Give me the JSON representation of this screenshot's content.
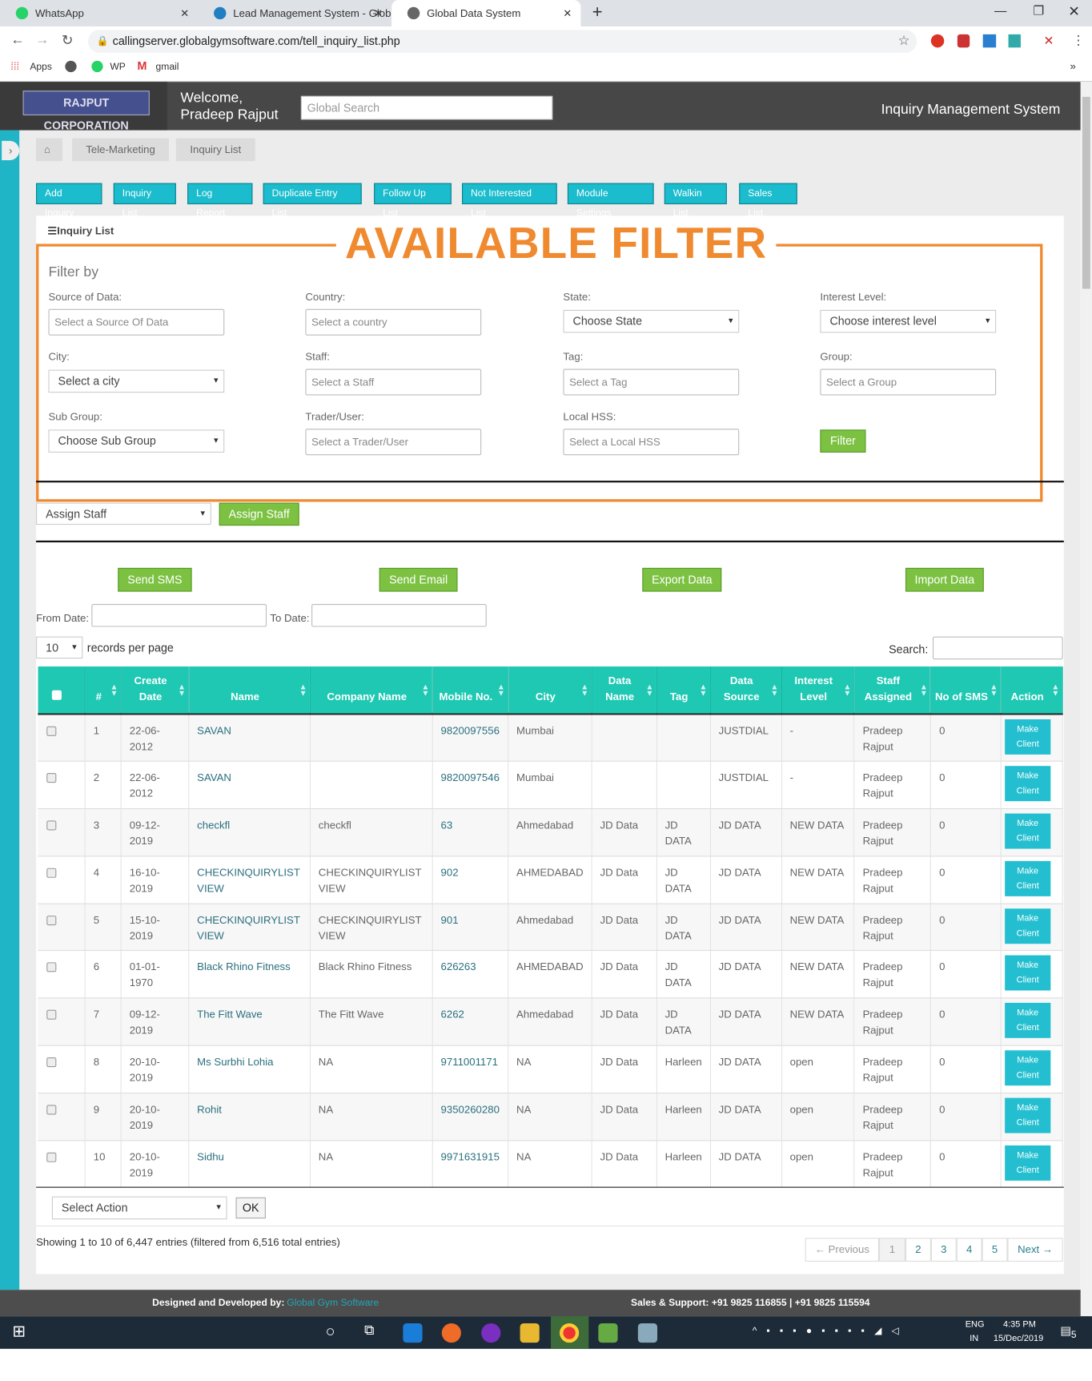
{
  "browser": {
    "tabs": [
      {
        "label": "WhatsApp",
        "color": "#25d366"
      },
      {
        "label": "Lead Management System - Glob",
        "color": "#1f7fc0"
      },
      {
        "label": "Global Data System",
        "color": "#555"
      }
    ],
    "url": "callingserver.globalgymsoftware.com/tell_inquiry_list.php",
    "bookmarks": [
      "Apps",
      "WP",
      "gmail"
    ]
  },
  "header": {
    "logo": "RAJPUT CORPORATION",
    "welcome": "Welcome,",
    "user": "Pradeep Rajput",
    "search_placeholder": "Global Search",
    "app_title": "Inquiry Management System"
  },
  "breadcrumb": [
    "Tele-Marketing",
    "Inquiry List"
  ],
  "nav": [
    "Add Inquiry",
    "Inquiry List",
    "Log Report",
    "Duplicate Entry List",
    "Follow Up List",
    "Not Interested List",
    "Module Settings",
    "Walkin List",
    "Sales List"
  ],
  "panel_title": "Inquiry List",
  "annotation": "AVAILABLE FILTER",
  "filter": {
    "title": "Filter by",
    "fields": [
      {
        "label": "Source of Data:",
        "value": "Select a Source Of Data",
        "kind": "input"
      },
      {
        "label": "Country:",
        "value": "Select a country",
        "kind": "input"
      },
      {
        "label": "State:",
        "value": "Choose State",
        "kind": "select"
      },
      {
        "label": "Interest Level:",
        "value": "Choose interest level",
        "kind": "select"
      },
      {
        "label": "City:",
        "value": "Select a city",
        "kind": "select"
      },
      {
        "label": "Staff:",
        "value": "Select a Staff",
        "kind": "input"
      },
      {
        "label": "Tag:",
        "value": "Select a Tag",
        "kind": "input"
      },
      {
        "label": "Group:",
        "value": "Select a Group",
        "kind": "input"
      },
      {
        "label": "Sub Group:",
        "value": "Choose Sub Group",
        "kind": "select"
      },
      {
        "label": "Trader/User:",
        "value": "Select a Trader/User",
        "kind": "input"
      },
      {
        "label": "Local HSS:",
        "value": "Select a Local HSS",
        "kind": "input"
      }
    ],
    "button": "Filter"
  },
  "assign": {
    "select": "Assign Staff",
    "button": "Assign Staff"
  },
  "actions": [
    "Send SMS",
    "Send Email",
    "Export Data",
    "Import Data"
  ],
  "dates": {
    "from": "From Date:",
    "to": "To Date:"
  },
  "length": {
    "value": "10",
    "label": "records per page"
  },
  "search_label": "Search:",
  "table": {
    "columns": [
      "#",
      "Create Date",
      "Name",
      "Company Name",
      "Mobile No.",
      "City",
      "Data Name",
      "Tag",
      "Data Source",
      "Interest Level",
      "Staff Assigned",
      "No of SMS",
      "Action"
    ],
    "action_label": "Make Client",
    "rows": [
      [
        "1",
        "22-06-2012",
        "SAVAN",
        "",
        "9820097556",
        "Mumbai",
        "",
        "",
        "JUSTDIAL",
        "-",
        "Pradeep Rajput",
        "0"
      ],
      [
        "2",
        "22-06-2012",
        "SAVAN",
        "",
        "9820097546",
        "Mumbai",
        "",
        "",
        "JUSTDIAL",
        "-",
        "Pradeep Rajput",
        "0"
      ],
      [
        "3",
        "09-12-2019",
        "checkfl",
        "checkfl",
        "63",
        "Ahmedabad",
        "JD Data",
        "JD DATA",
        "JD DATA",
        "NEW DATA",
        "Pradeep Rajput",
        "0"
      ],
      [
        "4",
        "16-10-2019",
        "CHECKINQUIRYLIST VIEW",
        "CHECKINQUIRYLIST VIEW",
        "902",
        "AHMEDABAD",
        "JD Data",
        "JD DATA",
        "JD DATA",
        "NEW DATA",
        "Pradeep Rajput",
        "0"
      ],
      [
        "5",
        "15-10-2019",
        "CHECKINQUIRYLIST VIEW",
        "CHECKINQUIRYLIST VIEW",
        "901",
        "Ahmedabad",
        "JD Data",
        "JD DATA",
        "JD DATA",
        "NEW DATA",
        "Pradeep Rajput",
        "0"
      ],
      [
        "6",
        "01-01-1970",
        "Black Rhino Fitness",
        "Black Rhino Fitness",
        "626263",
        "AHMEDABAD",
        "JD Data",
        "JD DATA",
        "JD DATA",
        "NEW DATA",
        "Pradeep Rajput",
        "0"
      ],
      [
        "7",
        "09-12-2019",
        "The Fitt Wave",
        "The Fitt Wave",
        "6262",
        "Ahmedabad",
        "JD Data",
        "JD DATA",
        "JD DATA",
        "NEW DATA",
        "Pradeep Rajput",
        "0"
      ],
      [
        "8",
        "20-10-2019",
        "Ms Surbhi Lohia",
        "NA",
        "9711001171",
        "NA",
        "JD Data",
        "Harleen",
        "JD DATA",
        "open",
        "Pradeep Rajput",
        "0"
      ],
      [
        "9",
        "20-10-2019",
        "Rohit",
        "NA",
        "9350260280",
        "NA",
        "JD Data",
        "Harleen",
        "JD DATA",
        "open",
        "Pradeep Rajput",
        "0"
      ],
      [
        "10",
        "20-10-2019",
        "Sidhu",
        "NA",
        "9971631915",
        "NA",
        "JD Data",
        "Harleen",
        "JD DATA",
        "open",
        "Pradeep Rajput",
        "0"
      ]
    ]
  },
  "bulk": {
    "select": "Select Action",
    "ok": "OK"
  },
  "info": "Showing 1 to 10 of 6,447 entries (filtered from 6,516 total entries)",
  "pagination": [
    "← Previous",
    "1",
    "2",
    "3",
    "4",
    "5",
    "Next →"
  ],
  "footer": {
    "designed": "Designed and Developed by:",
    "company": "Global Gym Software",
    "support": "Sales & Support: +91 9825 116855 | +91 9825 115594"
  },
  "taskbar": {
    "lang1": "ENG",
    "lang2": "IN",
    "time": "4:35 PM",
    "date": "15/Dec/2019",
    "notif": "5"
  },
  "colors": {
    "accent": "#1bbccd",
    "green": "#7cc142",
    "orange": "#f08a30",
    "table_header": "#1ec8b3"
  }
}
